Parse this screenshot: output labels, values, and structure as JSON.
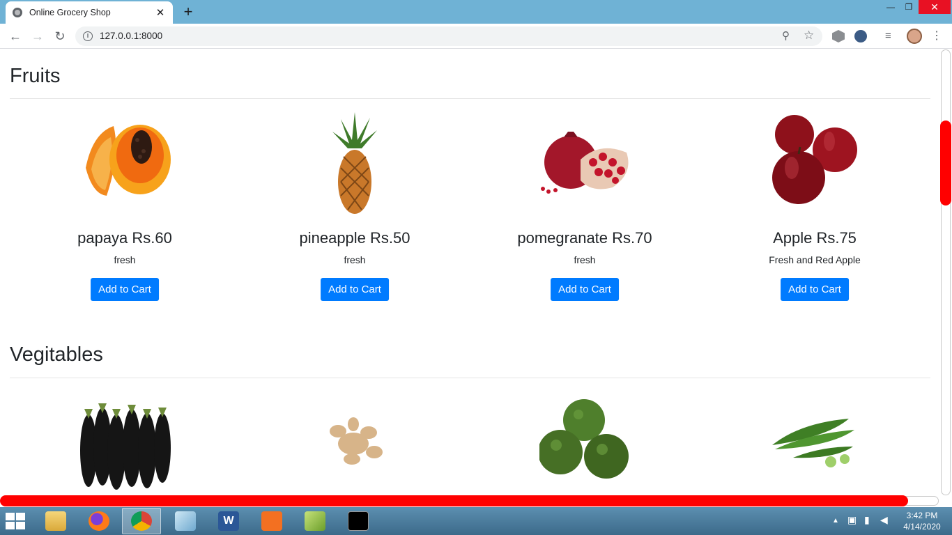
{
  "browser": {
    "tab_title": "Online Grocery Shop",
    "url": "127.0.0.1:8000",
    "new_tab": "+",
    "close_tab": "✕"
  },
  "sections": [
    {
      "title": "Fruits",
      "items": [
        {
          "name": "papaya Rs.60",
          "description": "fresh",
          "button": "Add to Cart"
        },
        {
          "name": "pineapple Rs.50",
          "description": "fresh",
          "button": "Add to Cart"
        },
        {
          "name": "pomegranate Rs.70",
          "description": "fresh",
          "button": "Add to Cart"
        },
        {
          "name": "Apple Rs.75",
          "description": "Fresh and Red Apple",
          "button": "Add to Cart"
        }
      ]
    },
    {
      "title": "Vegitables",
      "items": [
        {
          "image": "brinjal-image"
        },
        {
          "image": "ginger-image"
        },
        {
          "image": "broccoli-image"
        },
        {
          "image": "okra-image"
        }
      ]
    }
  ],
  "taskbar": {
    "time": "3:42 PM",
    "date": "4/14/2020"
  },
  "colors": {
    "primary_button": "#007bff",
    "scroll_thumb": "#ff0000",
    "tabstrip": "#6fb2d5"
  }
}
